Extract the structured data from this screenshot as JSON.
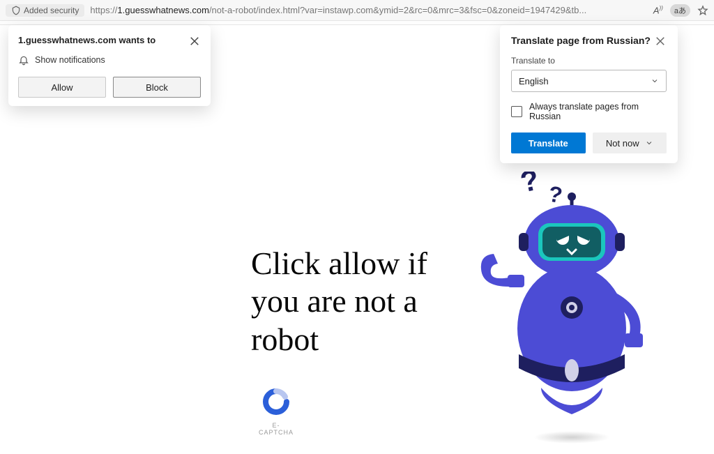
{
  "addressBar": {
    "securityLabel": "Added security",
    "urlPrefix": "https://",
    "urlDomain": "1.guesswhatnews.com",
    "urlPath": "/not-a-robot/index.html?var=instawp.com&ymid=2&rc=0&mrc=3&fsc=0&zoneid=1947429&tb...",
    "readAloudIcon": "A))",
    "translateBadge": "aあ"
  },
  "notifications": {
    "title": "1.guesswhatnews.com wants to",
    "permissionText": "Show notifications",
    "allowLabel": "Allow",
    "blockLabel": "Block"
  },
  "translate": {
    "title": "Translate page from Russian?",
    "toLabel": "Translate to",
    "selectedLanguage": "English",
    "alwaysLabel": "Always translate pages from Russian",
    "translateBtn": "Translate",
    "notNowBtn": "Not now"
  },
  "page": {
    "headline": "Click allow if you are not a robot",
    "captchaLabel": "E-CAPTCHA"
  },
  "colors": {
    "robotBody": "#4c4cd5",
    "robotDark": "#1e1f5f",
    "visor": "#115e63",
    "visorFrame": "#1bc6bd",
    "accentBlue": "#0078d4"
  }
}
